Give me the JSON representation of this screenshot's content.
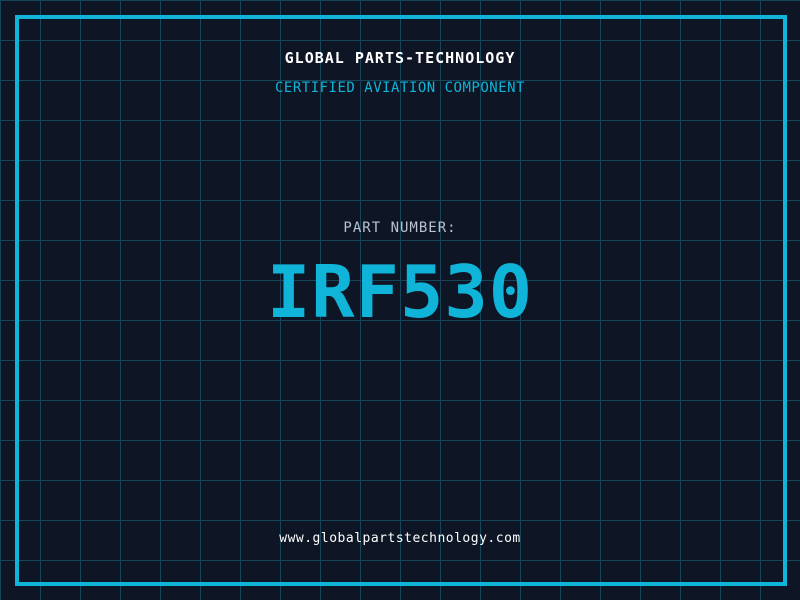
{
  "brand": {
    "title": "GLOBAL PARTS-TECHNOLOGY",
    "subtitle": "CERTIFIED AVIATION COMPONENT"
  },
  "part": {
    "label": "PART NUMBER:",
    "number": "IRF530"
  },
  "footer": {
    "website": "www.globalpartstechnology.com"
  },
  "colors": {
    "background": "#0e1625",
    "grid": "#17465c",
    "accent": "#0fb4d8",
    "heading": "#ffffff",
    "muted": "#b9c3d0"
  }
}
